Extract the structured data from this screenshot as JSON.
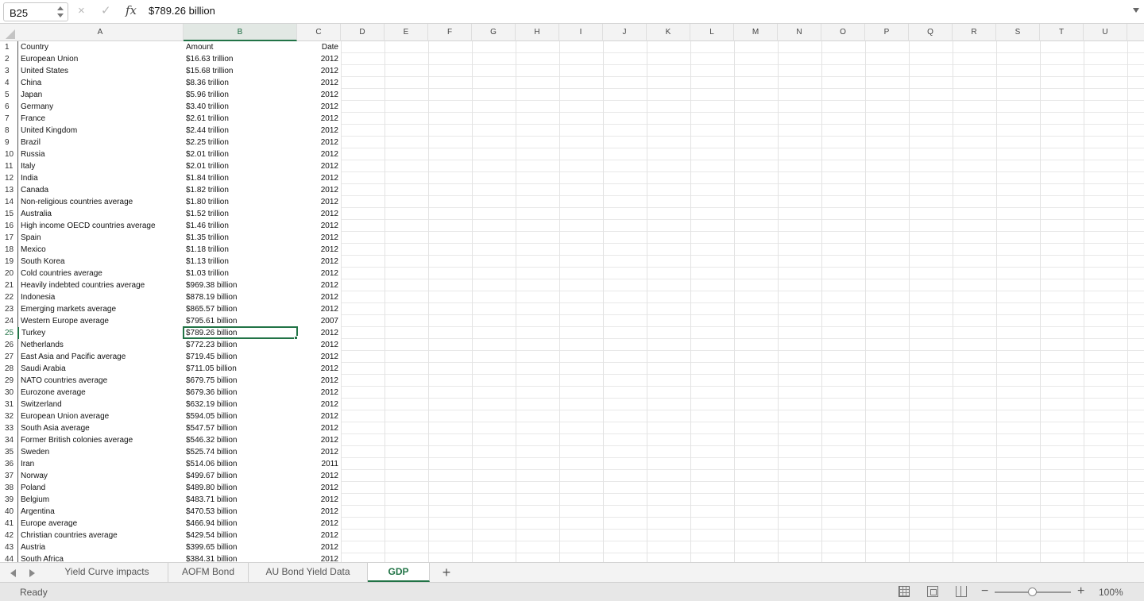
{
  "formula_bar": {
    "name_box": "B25",
    "cancel_icon": "×",
    "confirm_icon": "✓",
    "fx_label": "fx",
    "formula": "$789.26 billion"
  },
  "columns": [
    "A",
    "B",
    "C",
    "D",
    "E",
    "F",
    "G",
    "H",
    "I",
    "J",
    "K",
    "L",
    "M",
    "N",
    "O",
    "P",
    "Q",
    "R",
    "S",
    "T",
    "U"
  ],
  "active_column": "B",
  "active_row": "25",
  "rows": [
    {
      "n": "1",
      "a": "Country",
      "b": "Amount",
      "c": "Date"
    },
    {
      "n": "2",
      "a": "European Union",
      "b": "$16.63 trillion",
      "c": "2012"
    },
    {
      "n": "3",
      "a": "United States",
      "b": "$15.68 trillion",
      "c": "2012"
    },
    {
      "n": "4",
      "a": "China",
      "b": "$8.36 trillion",
      "c": "2012"
    },
    {
      "n": "5",
      "a": "Japan",
      "b": "$5.96 trillion",
      "c": "2012"
    },
    {
      "n": "6",
      "a": "Germany",
      "b": "$3.40 trillion",
      "c": "2012"
    },
    {
      "n": "7",
      "a": "France",
      "b": "$2.61 trillion",
      "c": "2012"
    },
    {
      "n": "8",
      "a": "United Kingdom",
      "b": "$2.44 trillion",
      "c": "2012"
    },
    {
      "n": "9",
      "a": "Brazil",
      "b": "$2.25 trillion",
      "c": "2012"
    },
    {
      "n": "10",
      "a": "Russia",
      "b": "$2.01 trillion",
      "c": "2012"
    },
    {
      "n": "11",
      "a": "Italy",
      "b": "$2.01 trillion",
      "c": "2012"
    },
    {
      "n": "12",
      "a": "India",
      "b": "$1.84 trillion",
      "c": "2012"
    },
    {
      "n": "13",
      "a": "Canada",
      "b": "$1.82 trillion",
      "c": "2012"
    },
    {
      "n": "14",
      "a": "Non-religious countries average",
      "b": "$1.80 trillion",
      "c": "2012"
    },
    {
      "n": "15",
      "a": "Australia",
      "b": "$1.52 trillion",
      "c": "2012"
    },
    {
      "n": "16",
      "a": "High income OECD countries average",
      "b": "$1.46 trillion",
      "c": "2012"
    },
    {
      "n": "17",
      "a": "Spain",
      "b": "$1.35 trillion",
      "c": "2012"
    },
    {
      "n": "18",
      "a": "Mexico",
      "b": "$1.18 trillion",
      "c": "2012"
    },
    {
      "n": "19",
      "a": "South Korea",
      "b": "$1.13 trillion",
      "c": "2012"
    },
    {
      "n": "20",
      "a": "Cold countries average",
      "b": "$1.03 trillion",
      "c": "2012"
    },
    {
      "n": "21",
      "a": "Heavily indebted countries average",
      "b": "$969.38 billion",
      "c": "2012"
    },
    {
      "n": "22",
      "a": "Indonesia",
      "b": "$878.19 billion",
      "c": "2012"
    },
    {
      "n": "23",
      "a": "Emerging markets average",
      "b": "$865.57 billion",
      "c": "2012"
    },
    {
      "n": "24",
      "a": "Western Europe average",
      "b": "$795.61 billion",
      "c": "2007"
    },
    {
      "n": "25",
      "a": "Turkey",
      "b": "$789.26 billion",
      "c": "2012"
    },
    {
      "n": "26",
      "a": "Netherlands",
      "b": "$772.23 billion",
      "c": "2012"
    },
    {
      "n": "27",
      "a": "East Asia and Pacific average",
      "b": "$719.45 billion",
      "c": "2012"
    },
    {
      "n": "28",
      "a": "Saudi Arabia",
      "b": "$711.05 billion",
      "c": "2012"
    },
    {
      "n": "29",
      "a": "NATO countries average",
      "b": "$679.75 billion",
      "c": "2012"
    },
    {
      "n": "30",
      "a": "Eurozone average",
      "b": "$679.36 billion",
      "c": "2012"
    },
    {
      "n": "31",
      "a": "Switzerland",
      "b": "$632.19 billion",
      "c": "2012"
    },
    {
      "n": "32",
      "a": "European Union average",
      "b": "$594.05 billion",
      "c": "2012"
    },
    {
      "n": "33",
      "a": "South Asia average",
      "b": "$547.57 billion",
      "c": "2012"
    },
    {
      "n": "34",
      "a": "Former British colonies average",
      "b": "$546.32 billion",
      "c": "2012"
    },
    {
      "n": "35",
      "a": "Sweden",
      "b": "$525.74 billion",
      "c": "2012"
    },
    {
      "n": "36",
      "a": "Iran",
      "b": "$514.06 billion",
      "c": "2011"
    },
    {
      "n": "37",
      "a": "Norway",
      "b": "$499.67 billion",
      "c": "2012"
    },
    {
      "n": "38",
      "a": "Poland",
      "b": "$489.80 billion",
      "c": "2012"
    },
    {
      "n": "39",
      "a": "Belgium",
      "b": "$483.71 billion",
      "c": "2012"
    },
    {
      "n": "40",
      "a": "Argentina",
      "b": "$470.53 billion",
      "c": "2012"
    },
    {
      "n": "41",
      "a": "Europe average",
      "b": "$466.94 billion",
      "c": "2012"
    },
    {
      "n": "42",
      "a": "Christian countries average",
      "b": "$429.54 billion",
      "c": "2012"
    },
    {
      "n": "43",
      "a": "Austria",
      "b": "$399.65 billion",
      "c": "2012"
    },
    {
      "n": "44",
      "a": "South Africa",
      "b": "$384.31 billion",
      "c": "2012"
    }
  ],
  "sheet_tabs": [
    "Yield Curve impacts",
    "AOFM Bond",
    "AU Bond Yield Data",
    "GDP"
  ],
  "active_tab": "GDP",
  "add_sheet_label": "+",
  "status": {
    "text": "Ready",
    "zoom_minus": "−",
    "zoom_plus": "+",
    "zoom": "100%",
    "zoom_fraction": 0.5
  }
}
